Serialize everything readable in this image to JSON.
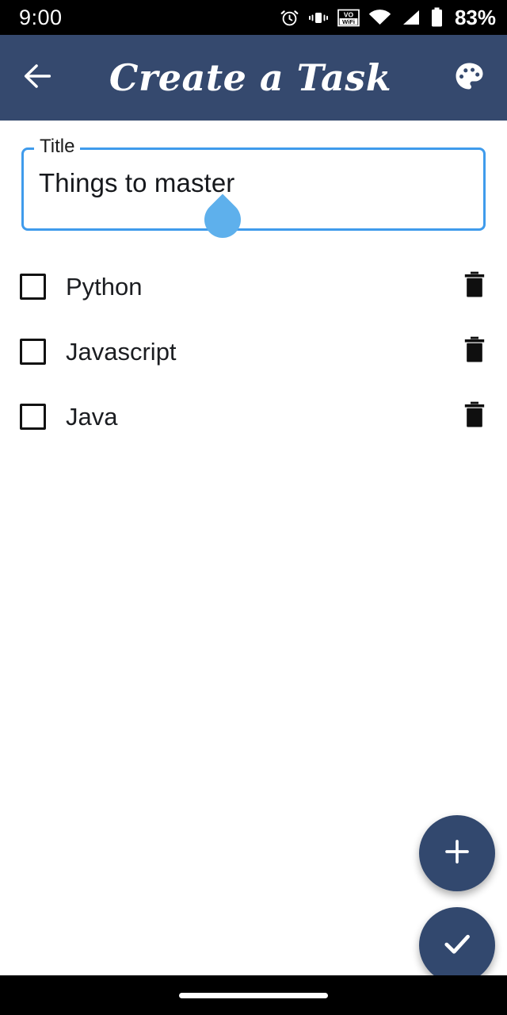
{
  "status_bar": {
    "time": "9:00",
    "battery_percent": "83%",
    "icons": [
      "alarm-icon",
      "vibrate-icon",
      "vowifi-icon",
      "wifi-icon",
      "signal-icon",
      "battery-icon"
    ]
  },
  "app_bar": {
    "back_label": "back-arrow",
    "title": "Create a Task",
    "action_label": "palette",
    "background_color": "#35496e"
  },
  "title_field": {
    "label": "Title",
    "value": "Things to master",
    "placeholder": "Title",
    "border_color": "#3f9bec",
    "handle_color": "#5eb0ec"
  },
  "checklist": {
    "items": [
      {
        "label": "Python",
        "checked": false
      },
      {
        "label": "Javascript",
        "checked": false
      },
      {
        "label": "Java",
        "checked": false
      }
    ]
  },
  "fabs": {
    "add_label": "+",
    "done_label": "✓",
    "color": "#32486e"
  }
}
